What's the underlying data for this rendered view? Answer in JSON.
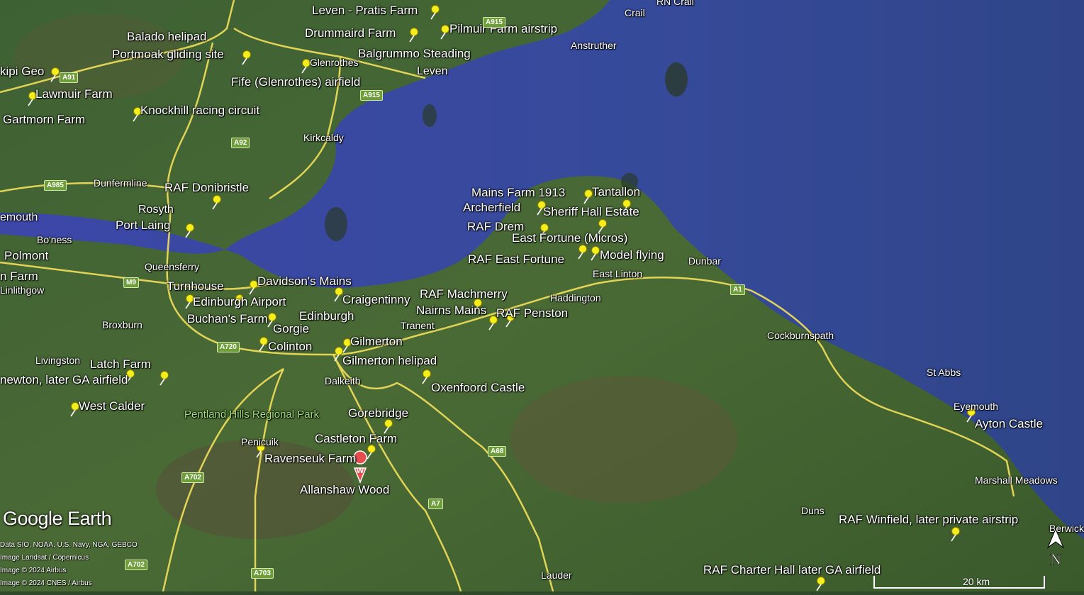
{
  "map": {
    "pins": [
      "Leven - Pratis Farm",
      "Balado helipad",
      "Drummaird Farm",
      "Pilmuir Farm airstrip",
      "Portmoak gliding site",
      "Balgrummo Steading",
      "kipi Geo",
      "Fife (Glenrothes) airfield",
      "Lawmuir Farm",
      "Knockhill racing circuit",
      "Gartmorn Farm",
      "RAF Donibristle",
      "Port Laing",
      "Mains Farm 1913",
      "Tantallon",
      "Archerfield",
      "Sheriff Hall Estate",
      "RAF Drem",
      "East Fortune (Micros)",
      "RAF East Fortune",
      "Model flying",
      "Davidson's Mains",
      "Turnhouse",
      "Craigentinny",
      "Edinburgh Airport",
      "RAF Machmerry",
      "Nairns Mains",
      "RAF Penston",
      "Buchan's Farm",
      "Gorgie",
      "Colinton",
      "Gilmerton",
      "Gilmerton helipad",
      "Latch Farm",
      "newton, later GA airfield",
      "Oxenfoord Castle",
      "West Calder",
      "Gorebridge",
      "Castleton Farm",
      "Ravenseuk Farm",
      "Ayton Castle",
      "RAF Winfield, later private airstrip",
      "RAF Charter Hall later GA airfield",
      "Polmont",
      "n Farm"
    ],
    "wikipedia_pin": "Allanshaw Wood",
    "places": [
      "Crail",
      "RN Crail",
      "Anstruther",
      "Leven",
      "Glenrothes",
      "Kirkcaldy",
      "Dunfermline",
      "Rosyth",
      "emouth",
      "Bo'ness",
      "Queensferry",
      "Linlithgow",
      "Broxburn",
      "Edinburgh",
      "Livingston",
      "Tranent",
      "Haddington",
      "East Linton",
      "Dunbar",
      "Dalkeith",
      "Penicuik",
      "Cockburnspath",
      "St Abbs",
      "Eyemouth",
      "Marshall Meadows",
      "Duns",
      "Lauder",
      "Berwick"
    ],
    "park": "Pentland Hills Regional Park",
    "roads": [
      "A915",
      "A91",
      "A915",
      "A92",
      "A985",
      "M9",
      "A720",
      "A1",
      "A68",
      "A702",
      "A7",
      "A702",
      "A703"
    ]
  },
  "branding": {
    "logo": "Google Earth",
    "credits": [
      "Data SIO, NOAA, U.S. Navy, NGA, GEBCO",
      "Image Landsat / Copernicus",
      "Image © 2024 Airbus",
      "Image © 2024 CNES / Airbus"
    ]
  },
  "scale": {
    "label": "20 km"
  },
  "compass": {
    "label": "N"
  },
  "colors": {
    "sea": "#3a4a9e",
    "land": "#3b5a30",
    "road": "#f2e05a",
    "pin": "#f4ee1c",
    "label": "#ffffff"
  }
}
